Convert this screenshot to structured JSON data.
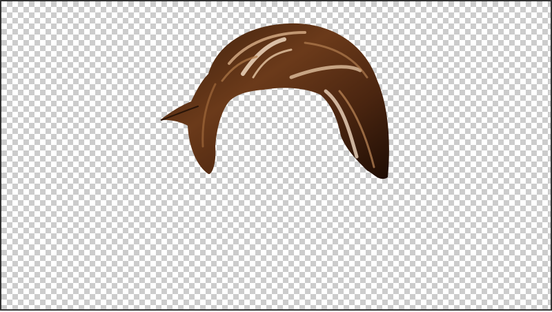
{
  "image": {
    "subject": "hair-cutout",
    "background": "transparency-checkerboard",
    "colors": {
      "hair_dark": "#2a1508",
      "hair_mid": "#6b3a1a",
      "hair_highlight": "#e8c9a8",
      "checker_light": "#ffffff",
      "checker_dark": "#cccccc"
    }
  }
}
